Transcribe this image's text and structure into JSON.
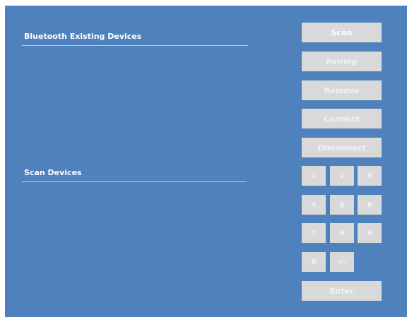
{
  "sections": {
    "existing_title": "Bluetooth Existing Devices",
    "scan_title": "Scan Devices"
  },
  "actions": {
    "scan": "Scan",
    "pairing": "Pairing",
    "remove": "Remove",
    "connect": "Connect",
    "disconnect": "Disconnect",
    "enter": "Enter"
  },
  "keypad": {
    "k1": "1",
    "k2": "2",
    "k3": "3",
    "k4": "4",
    "k5": "5",
    "k6": "6",
    "k7": "7",
    "k8": "8",
    "k9": "9",
    "k0": "0",
    "backspace": "<-"
  },
  "colors": {
    "background": "#4f81bd",
    "button": "#d9d9d9",
    "divider": "#c3d69b"
  }
}
